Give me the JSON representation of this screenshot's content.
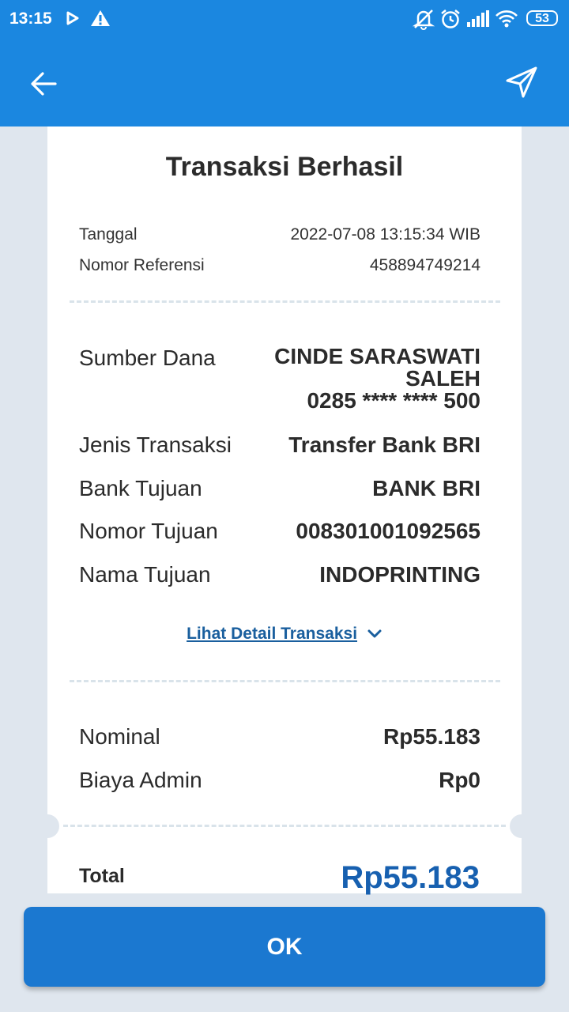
{
  "status_bar": {
    "time": "13:15",
    "battery": "53",
    "icons": [
      "play-icon",
      "warning-icon",
      "alarm-off-icon",
      "alarm-icon",
      "signal-icon",
      "wifi-icon",
      "battery-icon"
    ]
  },
  "app_bar": {
    "back_icon": "back-arrow-icon",
    "share_icon": "send-icon",
    "color": "#1b87e0"
  },
  "receipt": {
    "title": "Transaksi Berhasil",
    "header_rows": [
      {
        "label": "Tanggal",
        "value": "2022-07-08 13:15:34 WIB"
      },
      {
        "label": "Nomor Referensi",
        "value": "458894749214"
      }
    ],
    "source": {
      "label": "Sumber Dana",
      "name_line1": "CINDE SARASWATI",
      "name_line2": "SALEH",
      "account": "0285 **** **** 500"
    },
    "detail_rows": [
      {
        "label": "Jenis Transaksi",
        "value": "Transfer Bank BRI"
      },
      {
        "label": "Bank Tujuan",
        "value": "BANK BRI"
      },
      {
        "label": "Nomor Tujuan",
        "value": "008301001092565"
      },
      {
        "label": "Nama Tujuan",
        "value": "INDOPRINTING"
      }
    ],
    "detail_link": "Lihat Detail Transaksi",
    "amount_rows": [
      {
        "label": "Nominal",
        "value": "Rp55.183"
      },
      {
        "label": "Biaya Admin",
        "value": "Rp0"
      }
    ],
    "total_label": "Total",
    "total_value": "Rp55.183",
    "total_color": "#1760b0"
  },
  "ok_button": {
    "label": "OK",
    "color": "#1b78d0"
  }
}
